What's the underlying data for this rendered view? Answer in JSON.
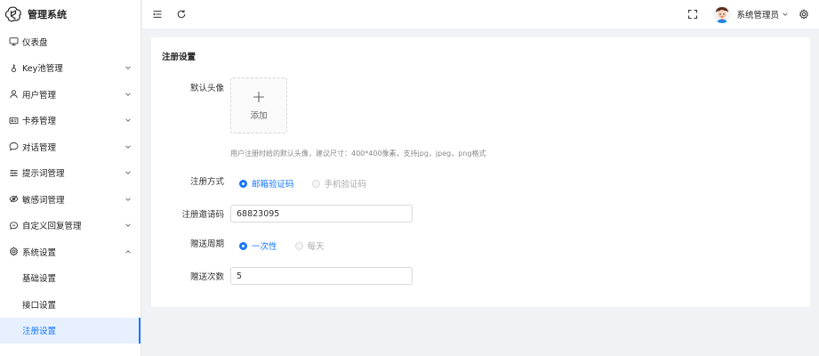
{
  "app": {
    "title": "管理系统"
  },
  "sidebar": {
    "items": [
      {
        "label": "仪表盘",
        "icon": "monitor-icon",
        "expandable": false
      },
      {
        "label": "Key池管理",
        "icon": "key-icon",
        "expandable": true
      },
      {
        "label": "用户管理",
        "icon": "user-icon",
        "expandable": true
      },
      {
        "label": "卡券管理",
        "icon": "card-icon",
        "expandable": true
      },
      {
        "label": "对话管理",
        "icon": "chat-icon",
        "expandable": true
      },
      {
        "label": "提示词管理",
        "icon": "sliders-icon",
        "expandable": true
      },
      {
        "label": "敏感词管理",
        "icon": "eye-off-icon",
        "expandable": true
      },
      {
        "label": "自定义回复管理",
        "icon": "reply-icon",
        "expandable": true
      },
      {
        "label": "系统设置",
        "icon": "gear-icon",
        "expandable": true,
        "expanded": true
      }
    ],
    "submenu": [
      {
        "label": "基础设置",
        "active": false
      },
      {
        "label": "接口设置",
        "active": false
      },
      {
        "label": "注册设置",
        "active": true
      }
    ]
  },
  "header": {
    "user_name": "系统管理员"
  },
  "form": {
    "title": "注册设置",
    "avatar_label": "默认头像",
    "upload_label": "添加",
    "avatar_hint": "用户注册时给的默认头像，建议尺寸：400*400像素，支持jpg，jpeg，png格式",
    "register_method_label": "注册方式",
    "register_methods": [
      {
        "label": "邮箱验证码",
        "checked": true
      },
      {
        "label": "手机验证码",
        "checked": false
      }
    ],
    "invite_code_label": "注册邀请码",
    "invite_code_value": "68823095",
    "gift_period_label": "赠送周期",
    "gift_periods": [
      {
        "label": "一次性",
        "checked": true
      },
      {
        "label": "每天",
        "checked": false
      }
    ],
    "gift_count_label": "赠送次数",
    "gift_count_value": "5"
  },
  "colors": {
    "accent": "#1677ff",
    "active_bg": "#e6f0ff",
    "page_bg": "#f0f2f5"
  }
}
